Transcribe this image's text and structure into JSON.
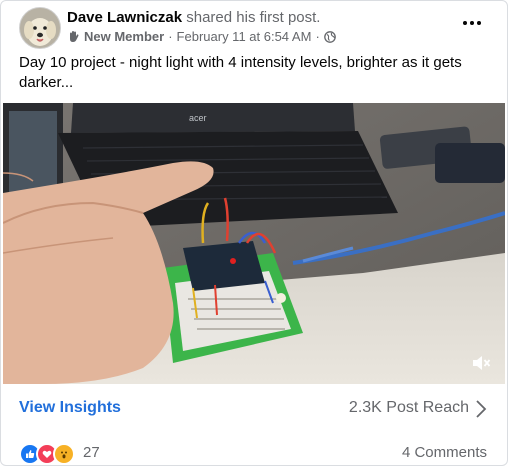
{
  "post": {
    "author": "Dave Lawniczak",
    "action": "shared his first post.",
    "badge": "New Member",
    "separator": "·",
    "date": "February 11 at 6:54 AM",
    "audience_icon": "globe-icon",
    "badge_icon": "wave-hand-icon",
    "text": "Day 10 project - night light with 4 intensity levels,  brighter as it gets darker..."
  },
  "media": {
    "laptop_brand": "acer",
    "mute_icon": "speaker-muted-icon"
  },
  "insights": {
    "link_label": "View Insights",
    "reach": "2.3K Post Reach"
  },
  "footer": {
    "reaction_icons": [
      "like-icon",
      "love-icon",
      "wow-icon"
    ],
    "reaction_count": "27",
    "comments": "4 Comments"
  },
  "colors": {
    "link_blue": "#216fdb",
    "secondary_text": "#65676b",
    "like_blue": "#1877f2",
    "love_red": "#f33e58",
    "wow_yellow": "#f7b125"
  }
}
